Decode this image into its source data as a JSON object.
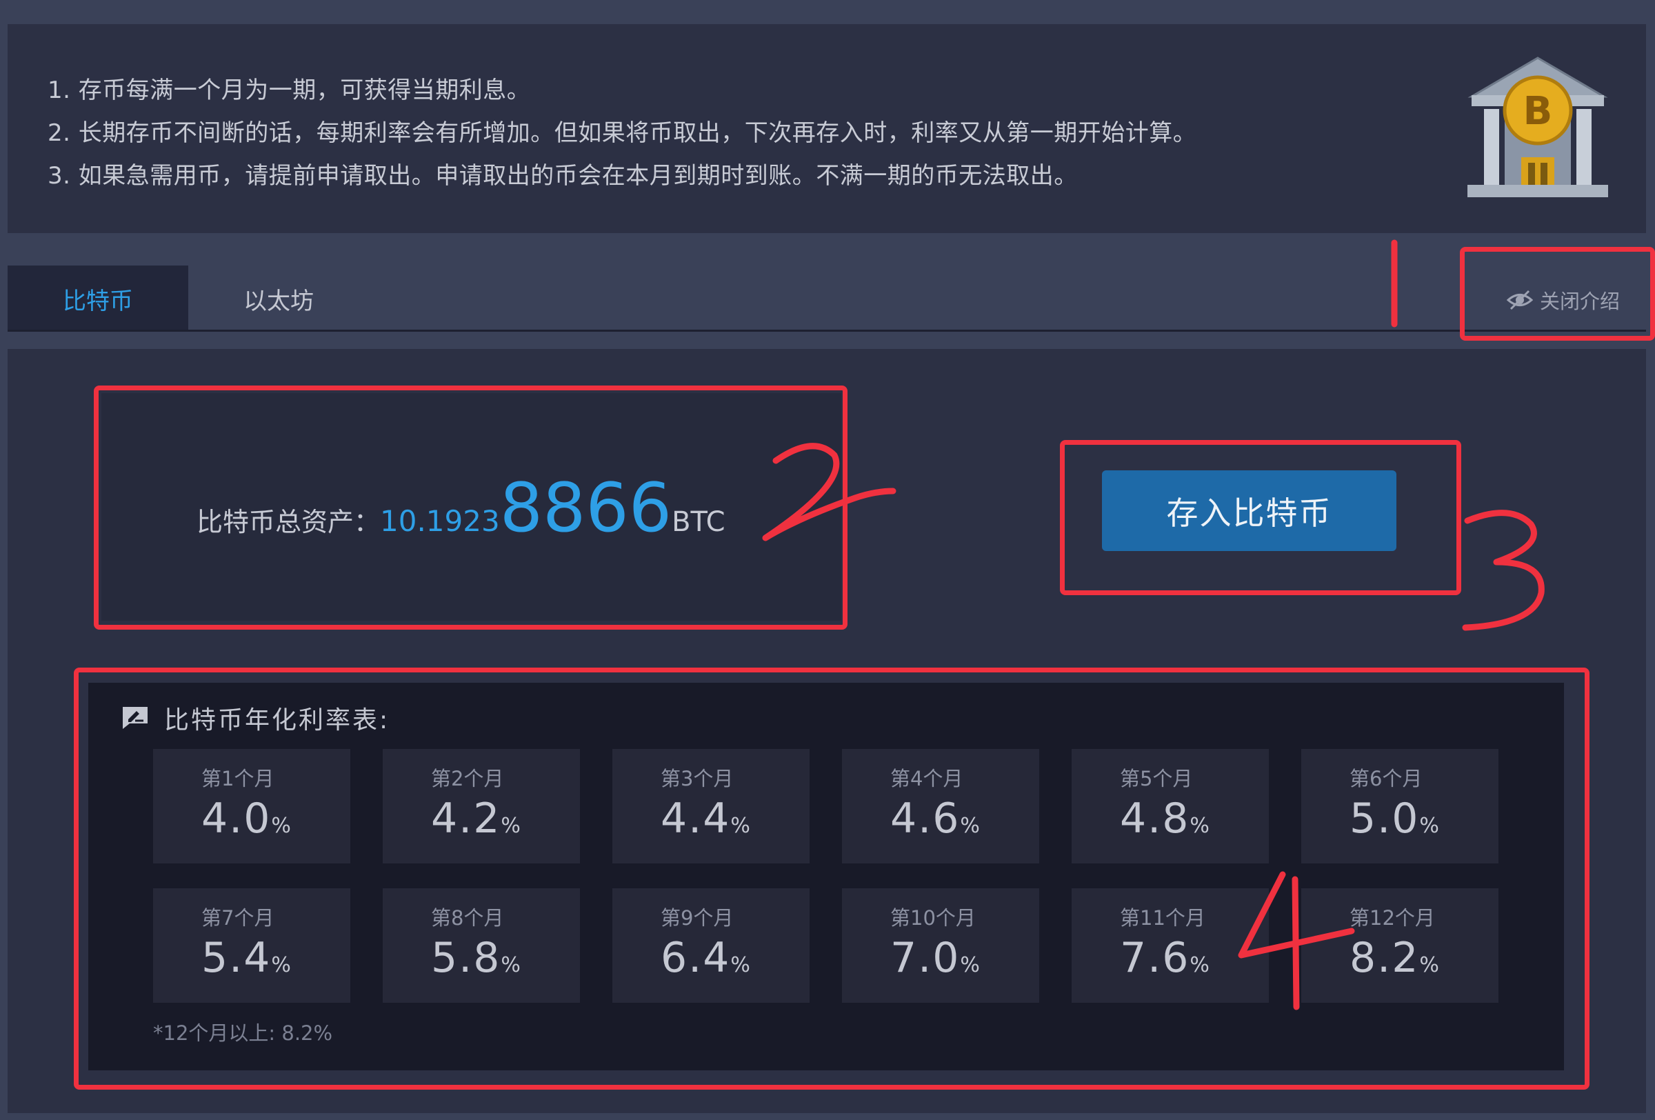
{
  "intro": {
    "lines": [
      "1. 存币每满一个月为一期，可获得当期利息。",
      "2. 长期存币不间断的话，每期利率会有所增加。但如果将币取出，下次再存入时，利率又从第一期开始计算。",
      "3. 如果急需用币，请提前申请取出。申请取出的币会在本月到期时到账。不满一期的币无法取出。"
    ],
    "icon": "bank-bitcoin-icon"
  },
  "tabs": {
    "items": [
      "比特币",
      "以太坊"
    ],
    "active": "比特币",
    "close_intro_label": "关闭介绍",
    "close_intro_icon": "eye-slash-icon"
  },
  "asset": {
    "label": "比特币总资产：",
    "amount_small": "10.1923",
    "amount_big": "8866",
    "unit": "BTC"
  },
  "deposit_button": "存入比特币",
  "rate_table": {
    "title": "比特币年化利率表:",
    "icon": "chat-edit-icon",
    "rows": [
      [
        {
          "month": "第1个月",
          "rate": "4.0",
          "unit": "%"
        },
        {
          "month": "第2个月",
          "rate": "4.2",
          "unit": "%"
        },
        {
          "month": "第3个月",
          "rate": "4.4",
          "unit": "%"
        },
        {
          "month": "第4个月",
          "rate": "4.6",
          "unit": "%"
        },
        {
          "month": "第5个月",
          "rate": "4.8",
          "unit": "%"
        },
        {
          "month": "第6个月",
          "rate": "5.0",
          "unit": "%"
        }
      ],
      [
        {
          "month": "第7个月",
          "rate": "5.4",
          "unit": "%"
        },
        {
          "month": "第8个月",
          "rate": "5.8",
          "unit": "%"
        },
        {
          "month": "第9个月",
          "rate": "6.4",
          "unit": "%"
        },
        {
          "month": "第10个月",
          "rate": "7.0",
          "unit": "%"
        },
        {
          "month": "第11个月",
          "rate": "7.6",
          "unit": "%"
        },
        {
          "month": "第12个月",
          "rate": "8.2",
          "unit": "%"
        }
      ]
    ],
    "note": "*12个月以上: 8.2%"
  },
  "annotations": {
    "labels": [
      "1",
      "2",
      "3",
      "4"
    ],
    "color": "#f0313f"
  },
  "colors": {
    "accent": "#2e9fe6",
    "button": "#1e6aa8",
    "panel": "#2c3044",
    "background": "#3a4158"
  }
}
